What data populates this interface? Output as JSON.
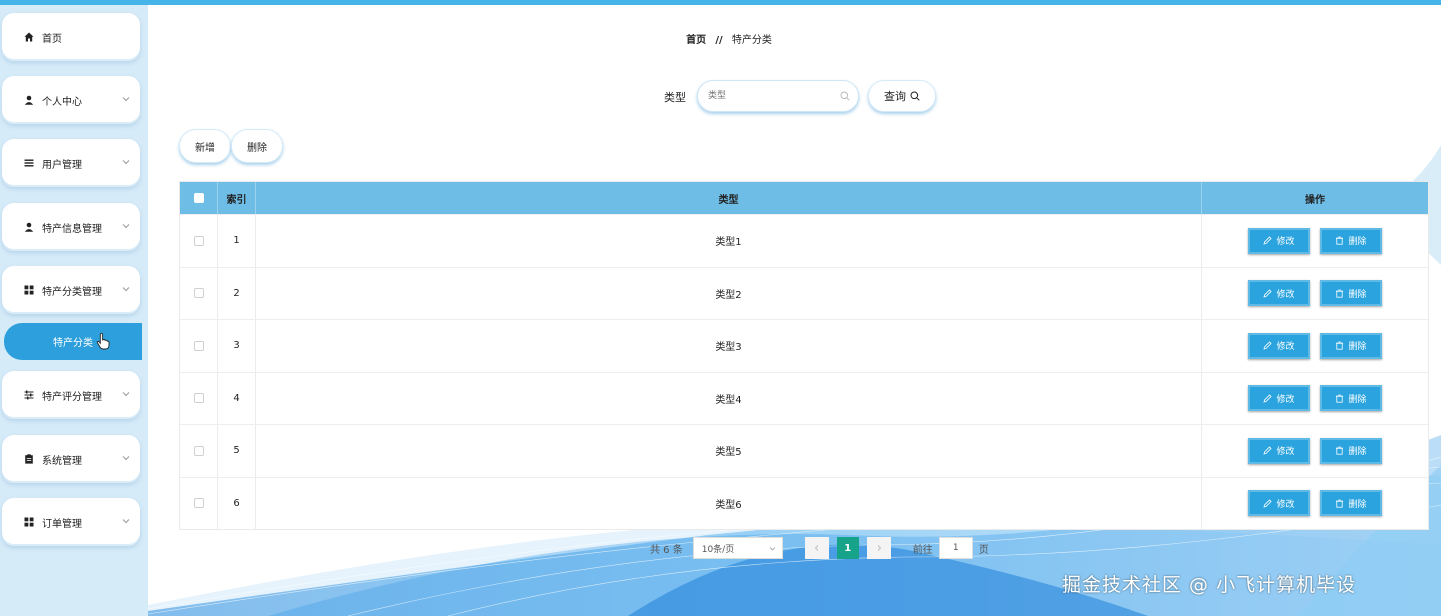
{
  "colors": {
    "accent": "#2aa3de",
    "header": "#6dbde6",
    "active_page": "#17a38a",
    "sidebar_bg": "#d6ebf8"
  },
  "sidebar": {
    "items": [
      {
        "label": "首页",
        "icon": "home-icon"
      },
      {
        "label": "个人中心",
        "icon": "user-icon"
      },
      {
        "label": "用户管理",
        "icon": "list-icon"
      },
      {
        "label": "特产信息管理",
        "icon": "user-icon"
      },
      {
        "label": "特产分类管理",
        "icon": "grid-icon"
      },
      {
        "label": "特产评分管理",
        "icon": "sliders-icon"
      },
      {
        "label": "系统管理",
        "icon": "clipboard-icon"
      },
      {
        "label": "订单管理",
        "icon": "grid-icon"
      }
    ],
    "active_sub": "特产分类"
  },
  "breadcrumb": {
    "home": "首页",
    "sep": "//",
    "current": "特产分类"
  },
  "search": {
    "label": "类型",
    "placeholder": "类型",
    "button": "查询"
  },
  "actions": {
    "add": "新增",
    "delete": "删除"
  },
  "table": {
    "headers": {
      "index": "索引",
      "type": "类型",
      "ops": "操作"
    },
    "rows": [
      {
        "index": "1",
        "type": "类型1"
      },
      {
        "index": "2",
        "type": "类型2"
      },
      {
        "index": "3",
        "type": "类型3"
      },
      {
        "index": "4",
        "type": "类型4"
      },
      {
        "index": "5",
        "type": "类型5"
      },
      {
        "index": "6",
        "type": "类型6"
      }
    ],
    "edit_label": "修改",
    "delete_label": "删除"
  },
  "pagination": {
    "total": "共 6 条",
    "page_size": "10条/页",
    "current": "1",
    "goto": "前往",
    "goto_value": "1",
    "page_unit": "页"
  },
  "watermark": "掘金技术社区 @ 小飞计算机毕设"
}
